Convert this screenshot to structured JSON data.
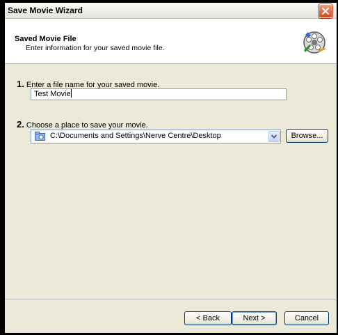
{
  "window": {
    "title": "Save Movie Wizard"
  },
  "header": {
    "title": "Saved Movie File",
    "subtitle": "Enter information for your saved movie file."
  },
  "steps": [
    {
      "number": "1.",
      "label": "Enter a file name for your saved movie."
    },
    {
      "number": "2.",
      "label": "Choose a place to save your movie."
    }
  ],
  "filename": {
    "value": "Test Movie"
  },
  "location": {
    "value": "C:\\Documents and Settings\\Nerve Centre\\Desktop"
  },
  "buttons": {
    "browse": "Browse...",
    "back": "< Back",
    "next": "Next >",
    "cancel": "Cancel"
  },
  "icons": {
    "close": "close-icon",
    "film": "film-reel-icon",
    "folder": "folder-icon",
    "dropdown": "chevron-down-icon"
  },
  "colors": {
    "header_bg": "#ffffff",
    "panel_bg": "#ece9d8",
    "close_button": "#d2451f",
    "input_border": "#7f9db9"
  }
}
